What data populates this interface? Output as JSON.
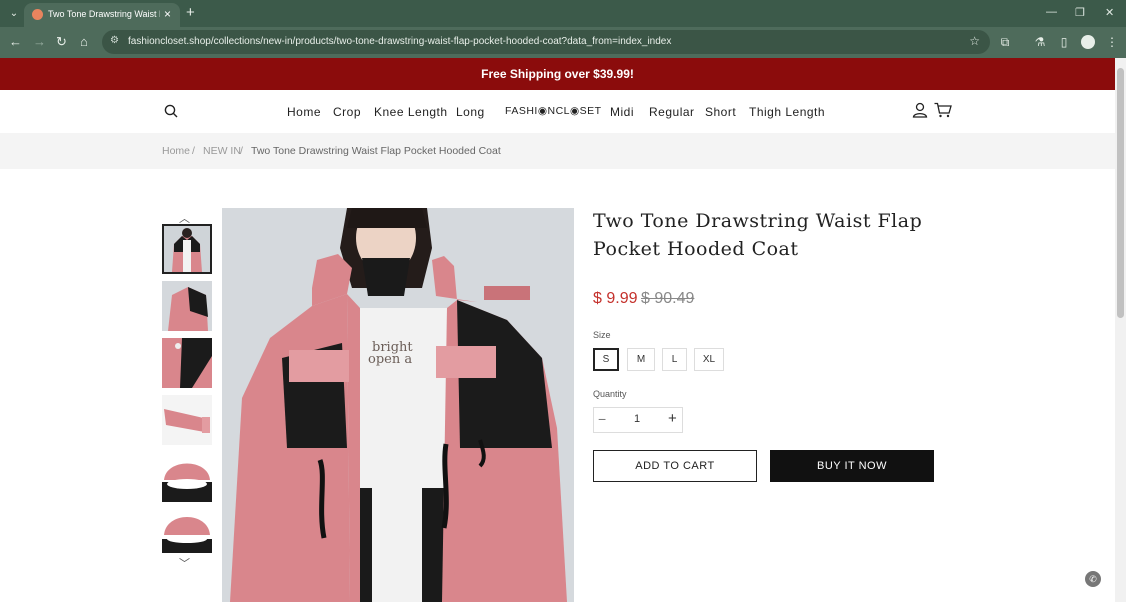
{
  "browser": {
    "tab_title": "Two Tone Drawstring Waist Flap",
    "url": "fashioncloset.shop/collections/new-in/products/two-tone-drawstring-waist-flap-pocket-hooded-coat?data_from=index_index"
  },
  "banner": {
    "text": "Free Shipping over $39.99!"
  },
  "header": {
    "nav_left": [
      "Home",
      "Crop",
      "Knee Length",
      "Long"
    ],
    "logo": "FASHI◉NCL◉SET",
    "nav_right": [
      "Midi",
      "Regular",
      "Short",
      "Thigh Length"
    ]
  },
  "breadcrumb": {
    "home": "Home",
    "sep": "/",
    "section": "NEW IN",
    "current": "Two Tone Drawstring Waist Flap Pocket Hooded Coat"
  },
  "product": {
    "title": "Two Tone Drawstring Waist Flap Pocket Hooded Coat",
    "price": "$ 9.99",
    "compare_price": "$ 90.49",
    "size_label": "Size",
    "sizes": [
      "S",
      "M",
      "L",
      "XL"
    ],
    "selected_size": "S",
    "quantity_label": "Quantity",
    "quantity": "1",
    "add_to_cart": "ADD TO CART",
    "buy_now": "BUY IT NOW"
  },
  "colors": {
    "banner": "#8b0c0c",
    "price": "#c4302b",
    "coat_pink": "#d98a8f"
  }
}
